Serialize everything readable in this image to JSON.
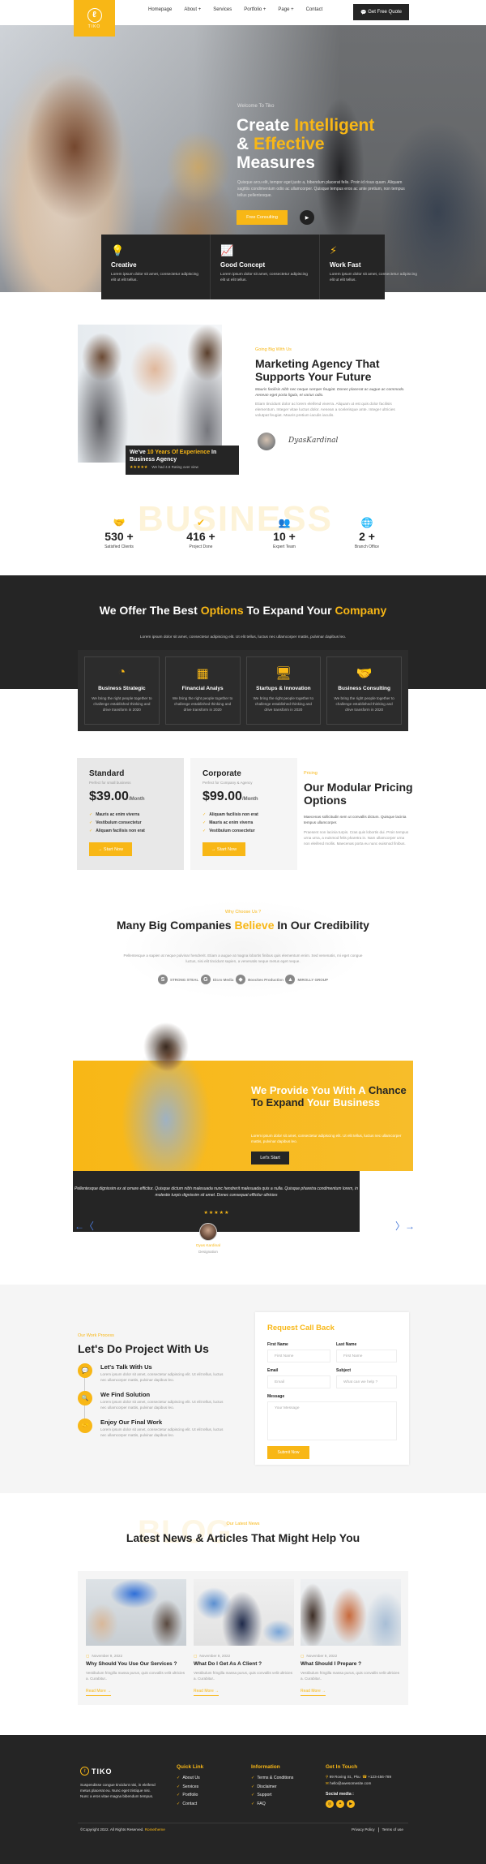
{
  "header": {
    "logo_text": "TIKO",
    "nav": [
      "Homepage",
      "About +",
      "Services",
      "Portfolio +",
      "Page +",
      "Contact"
    ],
    "quote_button": "Get Free Quote"
  },
  "hero": {
    "welcome": "Welcome To Tiko",
    "title_1": "Create ",
    "title_hl_1": "Intelligent",
    "title_2": "& ",
    "title_hl_2": "Effective",
    "title_3": "Measures",
    "description": "Quisque arcu elit, tempor eget justo a, bibendum placerat felis. Proin id risus quam. Aliquam sagittis condimentum odio ac ullamcorper. Quisque tempus eros ac ante pretium, non tempus tellus pellentesque.",
    "cta_button": "Free Consulting",
    "play_icon": "▶"
  },
  "features": [
    {
      "icon": "lightbulb-icon",
      "glyph": "💡",
      "title": "Creative",
      "text": "Lorem ipsum dolor sit amet, consectetur adipiscing elit ut elit tellus."
    },
    {
      "icon": "chart-board-icon",
      "glyph": "📈",
      "title": "Good Concept",
      "text": "Lorem ipsum dolor sit amet, consectetur adipiscing elit ut elit tellus."
    },
    {
      "icon": "lightning-icon",
      "glyph": "⚡",
      "title": "Work Fast",
      "text": "Lorem ipsum dolor sit amet, consectetur adipiscing elit ut elit tellus."
    }
  ],
  "about": {
    "experience_1": "We've ",
    "experience_hl": "10 Years Of Experience",
    "experience_2": " In Business Agency",
    "stars": "★★★★★",
    "rating_text": "We had 4.8 Rating over view",
    "tag": "Going Big With Us",
    "title": "Marketing Agency That Supports Your Future",
    "lead": "Mauris facilisis nibh nec neque semper feugiat. Donec placerat ac augue ac commodo. Aenean eget porta ligula, et varius odio.",
    "description": "Etiam tincidunt dolor ac lorem eleifend viverra. Aliquam ut est quis dolor facilisis elementum. Integer vitae luctus dolor. Aenean a scelerisque ante. Integer ultricies volutpat feugiat. Mauris pretium iaculis iaculis.",
    "signature": "DyasKardinal"
  },
  "stats": {
    "background_word": "BUSINESS",
    "items": [
      {
        "icon": "handshake-icon",
        "glyph": "🤝",
        "value": "530 +",
        "label": "Satisfied Clients"
      },
      {
        "icon": "check-badge-icon",
        "glyph": "✔",
        "value": "416 +",
        "label": "Project Done"
      },
      {
        "icon": "team-icon",
        "glyph": "👥",
        "value": "10 +",
        "label": "Expert Team"
      },
      {
        "icon": "globe-icon",
        "glyph": "🌐",
        "value": "2 +",
        "label": "Branch Office"
      }
    ]
  },
  "services": {
    "title_1": "We Offer The Best ",
    "title_hl_1": "Options",
    "title_2": " To Expand Your ",
    "title_hl_2": "Company",
    "subtitle": "Lorem ipsum dolor sit amet, consectetur adipiscing elit. Ut elit tellus, luctus nec ullamcorper mattis, pulvinar dapibus leo.",
    "items": [
      {
        "icon": "pie-chart-icon",
        "glyph": "◔",
        "title": "Business Strategic",
        "text": "We bring the right people together to challenge established thinking and drive transform in 2020"
      },
      {
        "icon": "calculator-icon",
        "glyph": "▦",
        "title": "Financial Analys",
        "text": "We bring the right people together to challenge established thinking and drive transform in 2020"
      },
      {
        "icon": "monitor-icon",
        "glyph": "🖥",
        "title": "Startups & Innovation",
        "text": "We bring the right people together to challenge established thinking and drive transform in 2020"
      },
      {
        "icon": "handshake-icon",
        "glyph": "🤝",
        "title": "Business Consulting",
        "text": "We bring the right people together to challenge established thinking and drive transform in 2020"
      }
    ]
  },
  "pricing": {
    "plans": [
      {
        "name": "Standard",
        "subtitle": "Perfect for small business",
        "price": "$39.00",
        "period": "/Month",
        "features": [
          "Mauris ac enim viverra",
          "Vestibulum consectetur",
          "Aliquam facilisis non erat"
        ],
        "button": "→ Start Now"
      },
      {
        "name": "Corporate",
        "subtitle": "Perfect for Company & Agency",
        "price": "$99.00",
        "period": "/Month",
        "features": [
          "Aliquam facilisis non erat",
          "Mauris ac enim viverra",
          "Vestibulum consectetur"
        ],
        "button": "→ Start Now"
      }
    ],
    "tag": "Pricing",
    "title": "Our Modular Pricing Options",
    "lead": "Maecenas sollicitudin sem ut convallis dictum. Quisque lacinia tempus ullamcorper.",
    "description": "Praesent non lacinia turpis. Cras quis lobortis dui. Proin tempus urna urna, a euismod felis pharetra in. Nam ullamcorper urna non eleifend mollis. Maecenas porta eu nunc euismod finibus."
  },
  "why_us": {
    "tag": "Why Choose Us ?",
    "title_1": "Many Big Companies ",
    "title_hl": "Believe",
    "title_2": " In Our Credibility",
    "description": "Pellentesque a sapien at neque pulvinar hendrerit. Etiam a augue at magna lobortis finibus quis elementum enim. Sed venenatis, mi eget congue luctus, nisi elit tincidunt sapien, a venenatis neque metus eget neque.",
    "brands": [
      {
        "icon": "strong-steal-logo",
        "glyph": "S",
        "name": "STRONG STEAL"
      },
      {
        "icon": "dicro-media-logo",
        "glyph": "G",
        "name": "Dicro Media"
      },
      {
        "icon": "boockes-production-logo",
        "glyph": "◆",
        "name": "Boockes Production"
      },
      {
        "icon": "mirolly-group-logo",
        "glyph": "▲",
        "name": "MIROLLY GROUP"
      }
    ]
  },
  "cta": {
    "title_1": "We Provide You With A ",
    "title_hl": "Chance To Expand",
    "title_2": " Your Business",
    "description": "Lorem ipsum dolor sit amet, consectetur adipiscing elit. Ut elit tellus, luctus nec ullamcorper mattis, pulvinar dapibus leo.",
    "button": "Let's Start"
  },
  "testimonial": {
    "quote": "Pellentesque dignissim ex at ornare efficitur. Quisque dictum nibh malesuada nunc hendrerit malesuada quis a nulla. Quisque pharetra condimentum lorem, in molestie turpis dignissim sit amet. Donec consequat efficitur ultricies",
    "stars": "★★★★★",
    "name": "Dyas Kardinal",
    "role": "Designation",
    "prev": "←〈",
    "next": "〉→"
  },
  "process": {
    "tag": "Our Work Process",
    "title": "Let's Do Project With Us",
    "steps": [
      {
        "icon": "chat-icon",
        "glyph": "💬",
        "title": "Let's Talk With Us",
        "text": "Lorem ipsum dolor sit amet, consectetur adipiscing elit. Ut elit tellus, luctus nec ullamcorper mattis, pulvinar dapibus leo."
      },
      {
        "icon": "search-doc-icon",
        "glyph": "🔍",
        "title": "We Find Solution",
        "text": "Lorem ipsum dolor sit amet, consectetur adipiscing elit. Ut elit tellus, luctus nec ullamcorper mattis, pulvinar dapibus leo."
      },
      {
        "icon": "handshake-icon",
        "glyph": "🤝",
        "title": "Enjoy Our Final Work",
        "text": "Lorem ipsum dolor sit amet, consectetur adipiscing elit. Ut elit tellus, luctus nec ullamcorper mattis, pulvinar dapibus leo."
      }
    ]
  },
  "form": {
    "title": "Request Call Back",
    "first_name_label": "First Name",
    "first_name_placeholder": "First Name",
    "last_name_label": "Last Name",
    "last_name_placeholder": "First Name",
    "email_label": "Email",
    "email_placeholder": "Email",
    "subject_label": "Subject",
    "subject_placeholder": "What can we help ?",
    "message_label": "Message",
    "message_placeholder": "Your Message",
    "submit": "Submit Now"
  },
  "news": {
    "background_word": "BLOG",
    "tag": "Our Latest News",
    "title": "Latest News & Articles That Might Help You",
    "posts": [
      {
        "date": "November 9, 2022",
        "title": "Why Should You Use Our Services ?",
        "excerpt": "Vestibulum fringilla massa purus, quis convallis velit ultricies a. Curabitur..",
        "link": "Read More →"
      },
      {
        "date": "November 9, 2022",
        "title": "What Do I Get As A Client ?",
        "excerpt": "Vestibulum fringilla massa purus, quis convallis velit ultricies a. Curabitur..",
        "link": "Read More →"
      },
      {
        "date": "November 9, 2022",
        "title": "What Should I Prepare ?",
        "excerpt": "Vestibulum fringilla massa purus, quis convallis velit ultricies a. Curabitur..",
        "link": "Read More →"
      }
    ]
  },
  "footer": {
    "logo_text": "TIKO",
    "about": "Suspendisse congue tincidunt nisi, in eleifend metus placerat eu. Nunc eget tristique nisi. Nunc a eros vitae magna bibendum tempus.",
    "quick_link_title": "Quick Link",
    "quick_links": [
      "About Us",
      "Services",
      "Portfolio",
      "Contact"
    ],
    "information_title": "Information",
    "information_links": [
      "Terms & Conditions",
      "Disclaimer",
      "Support",
      "FAQ"
    ],
    "contact_title": "Get In Touch",
    "address": "99 Roving St., Pku",
    "phone": "+123-456-789",
    "email": "hello@awesomesite.com",
    "social_label": "Social media :",
    "socials": [
      {
        "icon": "instagram-icon",
        "glyph": "◎"
      },
      {
        "icon": "twitter-icon",
        "glyph": "✦"
      },
      {
        "icon": "youtube-icon",
        "glyph": "▶"
      }
    ],
    "copyright": "©Copyright 2022. All Rights Reserved. ",
    "copyright_brand": "Rometheme",
    "privacy": "Privacy Policy",
    "terms": "Terms of use"
  },
  "colors": {
    "accent": "#f8b716",
    "dark": "#252525",
    "light_bg": "#f5f5f5"
  }
}
